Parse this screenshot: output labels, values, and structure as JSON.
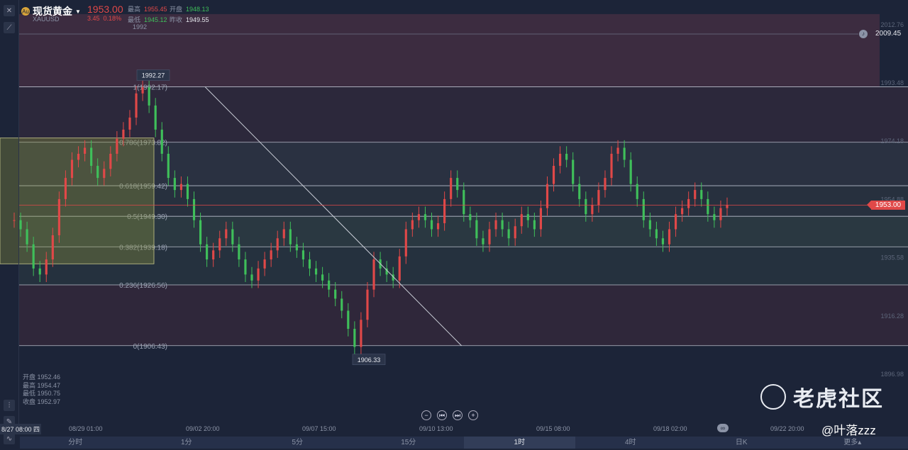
{
  "header": {
    "name": "现货黄金",
    "symbol": "XAUUSD",
    "price": "1953.00",
    "change": "3.45",
    "change_pct": "0.18%",
    "high_label": "最高",
    "high": "1955.45",
    "open_label": "开盘",
    "open": "1948.13",
    "low_label": "最低",
    "low": "1945.12",
    "prev_label": "昨收",
    "prev": "1949.55",
    "sub_value": "1992"
  },
  "colors": {
    "up": "#e04848",
    "down": "#3fbf5a",
    "background": "#1c2438"
  },
  "price_axis": {
    "ticks": [
      "2012.76",
      "1993.48",
      "1974.18",
      "1954.88",
      "1935.58",
      "1916.28",
      "1896.98"
    ],
    "current_price": "1953.00",
    "alert_price": "2009.45"
  },
  "fib": {
    "levels": [
      {
        "label": "1(1992.17)",
        "value": 1992.17
      },
      {
        "label": "0.786(1973.82)",
        "value": 1973.82
      },
      {
        "label": "0.618(1959.42)",
        "value": 1959.42
      },
      {
        "label": "0.5(1949.30)",
        "value": 1949.3
      },
      {
        "label": "0.382(1939.18)",
        "value": 1939.18
      },
      {
        "label": "0.236(1926.56)",
        "value": 1926.56
      },
      {
        "label": "0(1906.43)",
        "value": 1906.43
      }
    ],
    "high_marker": "1992.27",
    "low_marker": "1906.33"
  },
  "ohlc_box": {
    "open": "开盘 1952.46",
    "high": "最高 1954.47",
    "low": "最低 1950.75",
    "close": "收盘 1952.97"
  },
  "time_axis": {
    "current_label": "8/27 08:00 四",
    "labels": [
      "08/29 01:00",
      "09/02 20:00",
      "09/07 15:00",
      "09/10 13:00",
      "09/15 08:00",
      "09/18 02:00",
      "09/22 20:00"
    ]
  },
  "periods": [
    "分时",
    "1分",
    "5分",
    "15分",
    "1时",
    "4时",
    "日K",
    "更多▴"
  ],
  "active_period": "1时",
  "watermark": {
    "brand": "老虎社区",
    "author": "@叶落zzz"
  },
  "chart_data": {
    "type": "candlestick",
    "ylim": [
      1890,
      2016
    ],
    "fib_levels": [
      1992.17,
      1973.82,
      1959.42,
      1949.3,
      1939.18,
      1926.56,
      1906.43
    ],
    "trend_line": [
      [
        0.28,
        1992.2
      ],
      [
        0.52,
        1906.4
      ]
    ],
    "series": [
      {
        "values": [
          1948,
          1945,
          1940,
          1932,
          1930,
          1935,
          1943,
          1955,
          1962,
          1968,
          1970,
          1972,
          1966,
          1962,
          1965,
          1970,
          1975,
          1978,
          1982,
          1990,
          1992,
          1986,
          1978,
          1970,
          1962,
          1958,
          1960,
          1955,
          1948,
          1940,
          1935,
          1938,
          1942,
          1945,
          1940,
          1935,
          1930,
          1928,
          1932,
          1935,
          1938,
          1942,
          1945,
          1940,
          1938,
          1935,
          1932,
          1930,
          1928,
          1925,
          1922,
          1918,
          1912,
          1906,
          1915,
          1925,
          1935,
          1932,
          1930,
          1928,
          1936,
          1945,
          1948,
          1950,
          1948,
          1945,
          1947,
          1955,
          1962,
          1958,
          1950,
          1948,
          1942,
          1940,
          1945,
          1948,
          1945,
          1942,
          1946,
          1950,
          1948,
          1945,
          1952,
          1960,
          1966,
          1970,
          1968,
          1960,
          1955,
          1950,
          1953,
          1958,
          1962,
          1970,
          1972,
          1968,
          1960,
          1955,
          1948,
          1945,
          1942,
          1940,
          1945,
          1950,
          1952,
          1955,
          1958,
          1955,
          1950,
          1948,
          1952,
          1953
        ]
      }
    ]
  }
}
